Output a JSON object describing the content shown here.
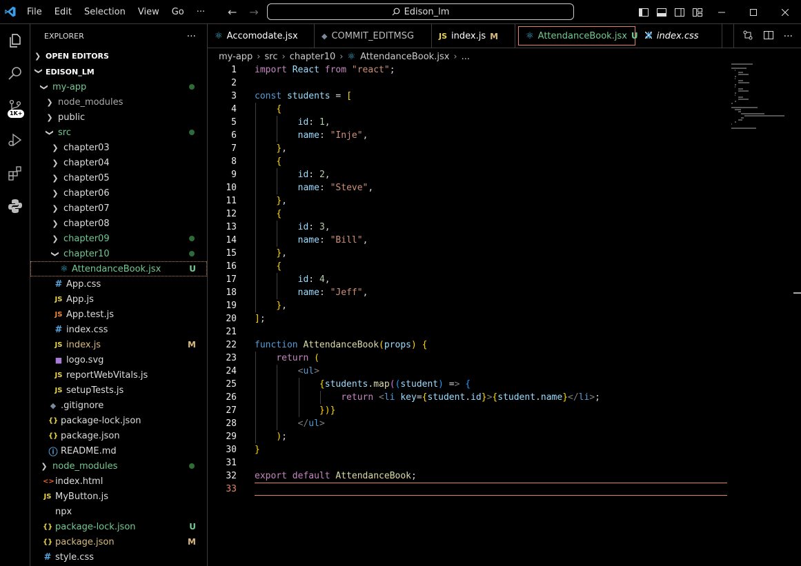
{
  "titlebar": {
    "menus": [
      "File",
      "Edit",
      "Selection",
      "View",
      "Go",
      "···"
    ],
    "command_center": "Edison_lm"
  },
  "sidebar": {
    "title": "EXPLORER",
    "more": "···",
    "open_editors": "OPEN EDITORS",
    "root": "EDISON_LM"
  },
  "tree": [
    {
      "label": "my-app",
      "indent": 1,
      "chev": "v",
      "color": "green",
      "dot": true
    },
    {
      "label": "node_modules",
      "indent": 2,
      "chev": ">",
      "color": "dim"
    },
    {
      "label": "public",
      "indent": 2,
      "chev": ">"
    },
    {
      "label": "src",
      "indent": 2,
      "chev": "v",
      "color": "green",
      "dot": true
    },
    {
      "label": "chapter03",
      "indent": 3,
      "chev": ">"
    },
    {
      "label": "chapter04",
      "indent": 3,
      "chev": ">"
    },
    {
      "label": "chapter05",
      "indent": 3,
      "chev": ">"
    },
    {
      "label": "chapter06",
      "indent": 3,
      "chev": ">"
    },
    {
      "label": "chapter07",
      "indent": 3,
      "chev": ">"
    },
    {
      "label": "chapter08",
      "indent": 3,
      "chev": ">"
    },
    {
      "label": "chapter09",
      "indent": 3,
      "chev": ">",
      "color": "green",
      "dot": true
    },
    {
      "label": "chapter10",
      "indent": 3,
      "chev": "v",
      "color": "green",
      "dot": true
    },
    {
      "label": "AttendanceBook.jsx",
      "indent": 4,
      "icon": "react",
      "color": "green",
      "badge": "U",
      "selected": true
    },
    {
      "label": "App.css",
      "indent": 3,
      "icon": "css"
    },
    {
      "label": "App.js",
      "indent": 3,
      "icon": "js"
    },
    {
      "label": "App.test.js",
      "indent": 3,
      "icon": "jstest"
    },
    {
      "label": "index.css",
      "indent": 3,
      "icon": "css"
    },
    {
      "label": "index.js",
      "indent": 3,
      "icon": "js",
      "color": "gold",
      "badge": "M"
    },
    {
      "label": "logo.svg",
      "indent": 3,
      "icon": "svg"
    },
    {
      "label": "reportWebVitals.js",
      "indent": 3,
      "icon": "js"
    },
    {
      "label": "setupTests.js",
      "indent": 3,
      "icon": "js"
    },
    {
      "label": ".gitignore",
      "indent": 2,
      "icon": "git"
    },
    {
      "label": "package-lock.json",
      "indent": 2,
      "icon": "json"
    },
    {
      "label": "package.json",
      "indent": 2,
      "icon": "json"
    },
    {
      "label": "README.md",
      "indent": 2,
      "icon": "info"
    },
    {
      "label": "node_modules",
      "indent": 1,
      "chev": ">",
      "color": "green",
      "dot": true
    },
    {
      "label": "index.html",
      "indent": 1,
      "icon": "html"
    },
    {
      "label": "MyButton.js",
      "indent": 1,
      "icon": "js"
    },
    {
      "label": "npx",
      "indent": 1,
      "icon": "none"
    },
    {
      "label": "package-lock.json",
      "indent": 1,
      "icon": "json",
      "color": "green",
      "badge": "U"
    },
    {
      "label": "package.json",
      "indent": 1,
      "icon": "json",
      "color": "gold",
      "badge": "M"
    },
    {
      "label": "style.css",
      "indent": 1,
      "icon": "css"
    }
  ],
  "tabs": [
    {
      "label": "Accomodate.jsx",
      "icon": "react"
    },
    {
      "label": "COMMIT_EDITMSG",
      "icon": "git"
    },
    {
      "label": "index.js",
      "icon": "js",
      "badge": "M"
    },
    {
      "label": "AttendanceBook.jsx",
      "icon": "react",
      "badge": "U",
      "active": true
    },
    {
      "label": "index.css",
      "icon": "css",
      "italic": true
    }
  ],
  "breadcrumb": [
    "my-app",
    "src",
    "chapter10",
    "AttendanceBook.jsx",
    "..."
  ],
  "activity": {
    "badge": "1K+"
  },
  "code_lines": [
    "import React from \"react\";",
    "",
    "const students = [",
    "    {",
    "        id: 1,",
    "        name: \"Inje\",",
    "    },",
    "    {",
    "        id: 2,",
    "        name: \"Steve\",",
    "    },",
    "    {",
    "        id: 3,",
    "        name: \"Bill\",",
    "    },",
    "    {",
    "        id: 4,",
    "        name: \"Jeff\",",
    "    },",
    "];",
    "",
    "function AttendanceBook(props) {",
    "    return (",
    "        <ul>",
    "            {students.map((student) => {",
    "                return <li key={student.id}>{student.name}</li>;",
    "            })}",
    "        </ul>",
    "    );",
    "}",
    "",
    "export default AttendanceBook;",
    ""
  ],
  "current_line": 33
}
